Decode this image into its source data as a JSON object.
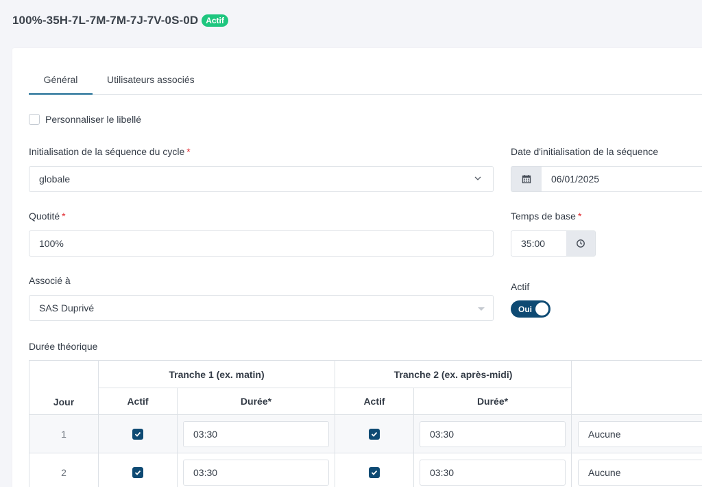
{
  "header": {
    "title": "100%-35H-7L-7M-7M-7J-7V-0S-0D",
    "status_badge": "Actif"
  },
  "tabs": [
    {
      "label": "Général",
      "active": true
    },
    {
      "label": "Utilisateurs associés",
      "active": false
    }
  ],
  "form": {
    "custom_label_checkbox": {
      "label": "Personnaliser le libellé",
      "checked": false
    },
    "cycle_init": {
      "label": "Initialisation de la séquence du cycle",
      "value": "globale",
      "required": true
    },
    "init_date": {
      "label": "Date d'initialisation de la séquence",
      "value": "06/01/2025"
    },
    "quotite": {
      "label": "Quotité",
      "value": "100%",
      "required": true
    },
    "base_time": {
      "label": "Temps de base",
      "value": "35:00",
      "required": true
    },
    "associated": {
      "label": "Associé à",
      "value": "SAS Duprivé"
    },
    "active": {
      "label": "Actif",
      "toggle_text": "Oui",
      "on": true
    }
  },
  "duree": {
    "label": "Durée théorique",
    "headers": {
      "jour": "Jour",
      "tranche1": "Tranche 1 (ex. matin)",
      "tranche2": "Tranche 2 (ex. après-midi)",
      "actif": "Actif",
      "duree": "Durée*"
    },
    "rows": [
      {
        "jour": "1",
        "t1_actif": true,
        "t1_duree": "03:30",
        "t2_actif": true,
        "t2_duree": "03:30",
        "option": "Aucune"
      },
      {
        "jour": "2",
        "t1_actif": true,
        "t1_duree": "03:30",
        "t2_actif": true,
        "t2_duree": "03:30",
        "option": "Aucune"
      }
    ]
  },
  "colors": {
    "accent": "#0e4a73",
    "badge": "#1ec67f",
    "required": "#e0262c",
    "tab_underline": "#1b6b93"
  },
  "icons": {
    "date_addon": "calendar-icon",
    "time_addon": "clock-icon",
    "select_arrow": "chevron-down-icon",
    "checkbox_mark": "checkmark-icon"
  }
}
